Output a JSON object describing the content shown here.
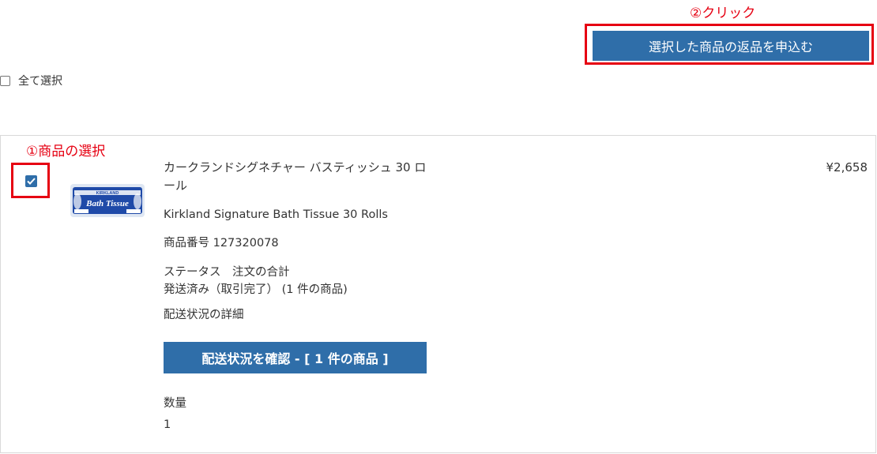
{
  "annotations": {
    "click": "②クリック",
    "select": "①商品の選択"
  },
  "header": {
    "return_button_label": "選択した商品の返品を申込む",
    "select_all_label": "全て選択"
  },
  "item": {
    "name_ja": "カークランドシグネチャー バスティッシュ 30 ロール",
    "name_en": "Kirkland Signature Bath Tissue 30 Rolls",
    "item_number": "商品番号 127320078",
    "status_line1": "ステータス　注文の合計",
    "status_line2": "発送済み（取引完了） (1 件の商品)",
    "tracking_detail": "配送状況の詳細",
    "tracking_button_label": "配送状況を確認 - [ 1 件の商品 ]",
    "quantity_label": "数量",
    "quantity_value": "1",
    "price": "¥2,658",
    "checked": true,
    "image_brand": "KIRKLAND",
    "image_product": "Bath Tissue"
  },
  "colors": {
    "accent_blue": "#2f6ea9",
    "annotation_red": "#e60012"
  }
}
